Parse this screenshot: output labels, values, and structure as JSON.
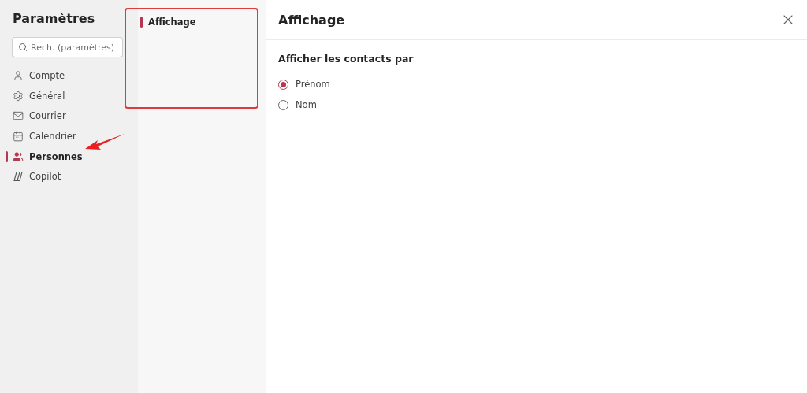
{
  "sidebar": {
    "title": "Paramètres",
    "search": {
      "placeholder": "Rech. (paramètres)"
    },
    "items": [
      {
        "label": "Compte",
        "selected": false
      },
      {
        "label": "Général",
        "selected": false
      },
      {
        "label": "Courrier",
        "selected": false
      },
      {
        "label": "Calendrier",
        "selected": false
      },
      {
        "label": "Personnes",
        "selected": true
      },
      {
        "label": "Copilot",
        "selected": false
      }
    ]
  },
  "subnav": {
    "items": [
      {
        "label": "Affichage",
        "selected": true
      }
    ]
  },
  "panel": {
    "title": "Affichage",
    "section": "Afficher les contacts par",
    "options": [
      {
        "label": "Prénom",
        "selected": true
      },
      {
        "label": "Nom",
        "selected": false
      }
    ]
  }
}
